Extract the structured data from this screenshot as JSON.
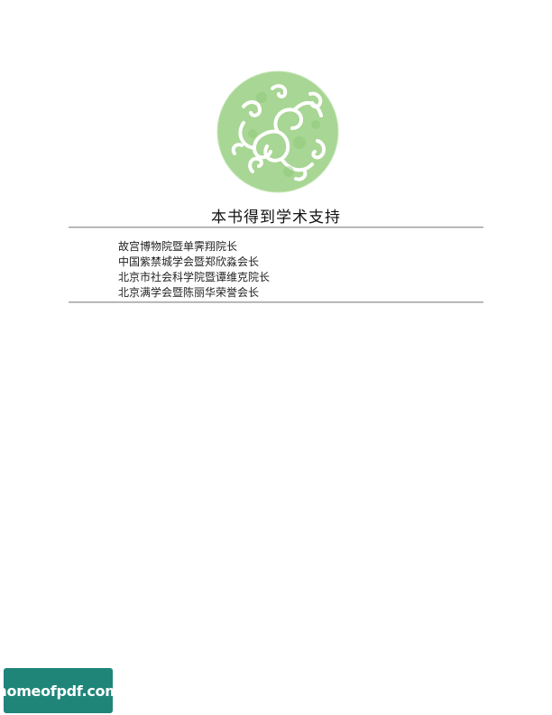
{
  "emblem": {
    "icon": "cloud-scroll-emblem-icon",
    "color": "#9fd28a"
  },
  "heading": "本书得到学术支持",
  "supporters": [
    "故宫博物院暨单霁翔院长",
    "中国紫禁城学会暨郑欣淼会长",
    "北京市社会科学院暨谭维克院长",
    "北京满学会暨陈丽华荣誉会长"
  ],
  "watermark": {
    "text": "homeofpdf.com",
    "color": "#1f8579"
  }
}
